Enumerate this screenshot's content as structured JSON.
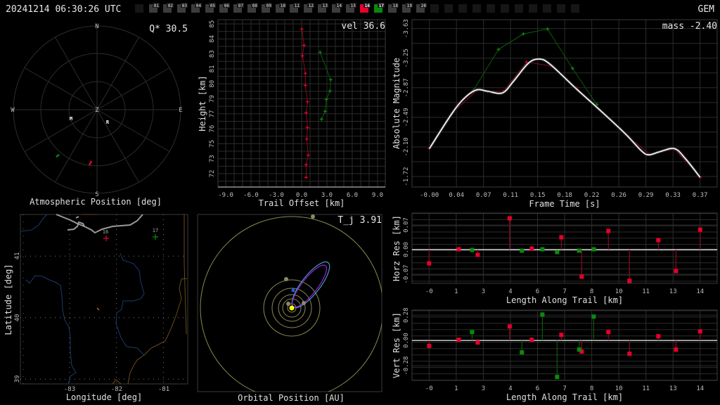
{
  "header": {
    "timestamp": "20241214 06:30:26 UTC",
    "station": "GEM",
    "frame_labels": [
      "01",
      "02",
      "03",
      "04",
      "05",
      "06",
      "07",
      "08",
      "09",
      "10",
      "11",
      "12",
      "13",
      "14",
      "15",
      "16",
      "17",
      "18",
      "19",
      "20"
    ],
    "frame_box_count": 32,
    "highlight_red": "16",
    "highlight_green": "17"
  },
  "colors": {
    "red": "#e8002a",
    "green": "#0a8a0a",
    "red_stem": "#8a0a22",
    "green_stem": "#0c5a0c",
    "fit": "#ffffff",
    "grid": "#2c2c2c",
    "orbit_ring": "#8a8a50",
    "orbit_purple": "#9a20f0",
    "orbit_teal": "#4a9aaa",
    "sun": "#ffff00",
    "earth": "#1060ff"
  },
  "polar": {
    "overlay": "Q* 30.5",
    "caption": "Atmospheric Position [deg]",
    "labels": {
      "n": "N",
      "s": "S",
      "e": "E",
      "w": "W",
      "z": "Z",
      "m": "M",
      "r": "R"
    }
  },
  "map": {
    "caption_x": "Longitude [deg]",
    "caption_y": "Latitude [deg]",
    "lon_ticks": [
      "-83",
      "-82",
      "-81"
    ],
    "lat_ticks": [
      "41",
      "40",
      "39"
    ],
    "stations": [
      {
        "label": "16",
        "color": "red"
      },
      {
        "label": "17",
        "color": "green"
      }
    ]
  },
  "orbit": {
    "overlay": "T_j 3.91",
    "caption": "Orbital Position [AU]"
  },
  "chart_data": [
    {
      "id": "height",
      "type": "scatter",
      "overlay": "vel 36.6",
      "xlabel": "Trail Offset [km]",
      "ylabel": "Height [km]",
      "xlim": [
        -9.92,
        9.92
      ],
      "ylim": [
        70.84,
        85.37
      ],
      "xticks": [
        -9,
        -6,
        -3,
        0,
        3,
        6,
        9
      ],
      "xtick_labels": [
        "-9.0",
        "-6.0",
        "-3.0",
        "0.0",
        "3.0",
        "6.0",
        "9.0"
      ],
      "yticks": [
        85,
        83.7,
        82.4,
        81.1,
        79.8,
        78.5,
        77.2,
        75.9,
        74.6,
        73.3,
        72.0
      ],
      "ytick_labels": [
        "85",
        "84",
        "83",
        "81",
        "80",
        "79",
        "77",
        "76",
        "75",
        "73",
        "72"
      ],
      "series": [
        {
          "name": "16",
          "color": "red",
          "x": [
            0.02,
            0.28,
            0.11,
            0.44,
            0.44,
            0.69,
            0.53,
            0.69,
            0.61,
            0.78,
            0.53,
            0.53
          ],
          "y": [
            84.55,
            83.15,
            82.23,
            80.71,
            79.67,
            78.24,
            77.29,
            76.01,
            75.01,
            73.6,
            72.77,
            71.67
          ]
        },
        {
          "name": "17",
          "color": "green",
          "x": [
            2.19,
            3.44,
            3.36,
            2.94,
            2.78,
            2.36
          ],
          "y": [
            82.54,
            80.16,
            79.18,
            78.45,
            77.41,
            76.73
          ]
        }
      ]
    },
    {
      "id": "magnitude",
      "type": "line",
      "overlay": "mass -2.40",
      "xlabel": "Frame Time [s]",
      "ylabel": "Absolute Magnitude",
      "xlim": [
        -0.0237,
        0.3934
      ],
      "ylim": [
        -3.745,
        -1.584
      ],
      "y_inverted": true,
      "xticks": [
        0,
        0.037,
        0.074,
        0.111,
        0.148,
        0.185,
        0.222,
        0.259,
        0.296,
        0.333,
        0.37
      ],
      "xtick_labels": [
        "-0.00",
        "0.04",
        "0.07",
        "0.11",
        "0.15",
        "0.18",
        "0.22",
        "0.26",
        "0.29",
        "0.33",
        "0.37"
      ],
      "yticks": [
        -3.63,
        -3.248,
        -2.866,
        -2.484,
        -2.102,
        -1.72
      ],
      "ytick_labels": [
        "-3.63",
        "-3.25",
        "-2.87",
        "-2.49",
        "-2.10",
        "-1.72"
      ],
      "series": [
        {
          "name": "16",
          "color": "red",
          "x": [
            0,
            0.0323,
            0.0656,
            0.1009,
            0.1329,
            0.1668,
            0.2011,
            0.2341,
            0.2675,
            0.3021,
            0.335,
            0.37
          ],
          "y": [
            -2.083,
            -2.547,
            -2.837,
            -2.816,
            -3.198,
            -3.146,
            -2.862,
            -2.567,
            -2.271,
            -2.002,
            -2.074,
            -1.711
          ]
        },
        {
          "name": "17",
          "color": "green",
          "x": [
            0.0602,
            0.0945,
            0.1284,
            0.1615,
            0.1957,
            0.229
          ],
          "y": [
            -2.834,
            -3.361,
            -3.561,
            -3.625,
            -3.116,
            -2.646
          ]
        },
        {
          "name": "fit",
          "color": "fit",
          "x": [
            0,
            0.032,
            0.05,
            0.065,
            0.08,
            0.1,
            0.115,
            0.135,
            0.15,
            0.165,
            0.2,
            0.234,
            0.268,
            0.29,
            0.3,
            0.315,
            0.335,
            0.35,
            0.37
          ],
          "y": [
            -2.08,
            -2.55,
            -2.75,
            -2.84,
            -2.82,
            -2.8,
            -2.95,
            -3.18,
            -3.237,
            -3.17,
            -2.86,
            -2.57,
            -2.27,
            -2.05,
            -2.0,
            -2.04,
            -2.08,
            -1.95,
            -1.71
          ]
        }
      ]
    },
    {
      "id": "horz-res",
      "type": "scatter",
      "xlabel": "Length Along Trail [km]",
      "ylabel": "Horz Res [km]",
      "xlim": [
        -0.883,
        14.88
      ],
      "ylim": [
        -0.096,
        0.104
      ],
      "xticks": [
        0,
        1.4,
        2.8,
        4.2,
        5.6,
        7.0,
        8.4,
        9.8,
        11.2,
        12.6,
        14.0
      ],
      "xtick_labels": [
        "-0",
        "1",
        "3",
        "4",
        "6",
        "7",
        "8",
        "10",
        "11",
        "13",
        "14"
      ],
      "yticks": [
        0.07,
        0,
        -0.07
      ],
      "ytick_labels": [
        "0.07",
        "0.00",
        "-0.07"
      ],
      "series": [
        {
          "name": "16",
          "color": "red",
          "x": [
            0,
            1.53,
            2.51,
            4.16,
            5.3,
            6.83,
            7.88,
            9.26,
            10.35,
            11.84,
            12.75,
            14.0
          ],
          "y": [
            -0.039,
            0.001,
            -0.015,
            0.089,
            0.003,
            0.035,
            -0.077,
            0.053,
            -0.089,
            0.027,
            -0.061,
            0.057
          ]
        },
        {
          "name": "17",
          "color": "green",
          "x": [
            2.22,
            4.79,
            5.85,
            6.61,
            7.75,
            8.5
          ],
          "y": [
            -0.001,
            -0.003,
            0.001,
            -0.007,
            -0.003,
            0.001
          ]
        }
      ]
    },
    {
      "id": "vert-res",
      "type": "scatter",
      "xlabel": "Length Along Trail [km]",
      "ylabel": "Vert Res [km]",
      "xlim": [
        -0.883,
        14.88
      ],
      "ylim": [
        -0.443,
        0.337
      ],
      "xticks": [
        0,
        1.4,
        2.8,
        4.2,
        5.6,
        7.0,
        8.4,
        9.8,
        11.2,
        12.6,
        14.0
      ],
      "xtick_labels": [
        "-0",
        "1",
        "3",
        "4",
        "6",
        "7",
        "8",
        "10",
        "11",
        "13",
        "14"
      ],
      "yticks": [
        0.28,
        0,
        -0.28
      ],
      "ytick_labels": [
        "0.28",
        "0.00",
        "-0.28"
      ],
      "series": [
        {
          "name": "16",
          "color": "red",
          "x": [
            0,
            1.53,
            2.51,
            4.16,
            5.3,
            6.83,
            7.88,
            9.26,
            10.35,
            11.84,
            12.75,
            14.0
          ],
          "y": [
            -0.06,
            0.008,
            -0.023,
            0.156,
            0.008,
            0.062,
            -0.124,
            0.093,
            -0.148,
            0.047,
            -0.101,
            0.101
          ]
        },
        {
          "name": "17",
          "color": "green",
          "x": [
            2.22,
            4.79,
            5.85,
            6.61,
            7.75,
            8.5
          ],
          "y": [
            0.093,
            -0.132,
            0.288,
            -0.405,
            -0.101,
            0.265
          ]
        }
      ]
    }
  ]
}
